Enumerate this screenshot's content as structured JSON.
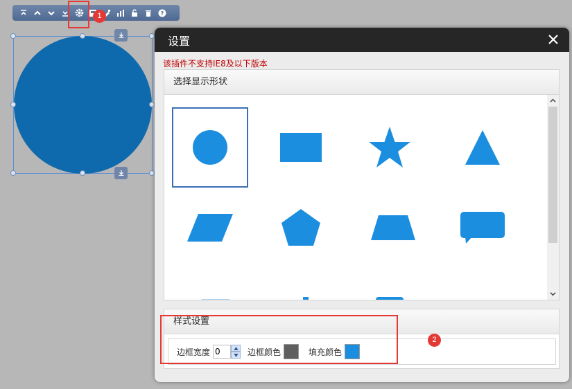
{
  "toolbar": {
    "buttons": [
      {
        "name": "move-top-icon",
        "glyph": "top"
      },
      {
        "name": "move-up-icon",
        "glyph": "up"
      },
      {
        "name": "move-down-icon",
        "glyph": "down"
      },
      {
        "name": "move-bottom-icon",
        "glyph": "bottom"
      },
      {
        "name": "gear-icon",
        "glyph": "gear"
      },
      {
        "name": "image-icon",
        "glyph": "image"
      },
      {
        "name": "brush-icon",
        "glyph": "brush"
      },
      {
        "name": "chart-icon",
        "glyph": "chart"
      },
      {
        "name": "unlock-icon",
        "glyph": "lock"
      },
      {
        "name": "trash-icon",
        "glyph": "trash"
      },
      {
        "name": "help-icon",
        "glyph": "help"
      }
    ]
  },
  "badges": {
    "step1": "1",
    "step2": "2"
  },
  "dialog": {
    "title": "设置",
    "warning": "该插件不支持IE8及以下版本",
    "shape_panel_title": "选择显示形状",
    "style_panel_title": "样式设置",
    "shapes": [
      "circle",
      "rectangle",
      "star",
      "triangle",
      "parallelogram",
      "pentagon",
      "trapezoid",
      "speech-bubble"
    ],
    "selected_shape": "circle",
    "style": {
      "border_width_label": "边框宽度",
      "border_width_value": "0",
      "border_color_label": "边框颜色",
      "border_color": "#5f5f5f",
      "fill_color_label": "填充颜色",
      "fill_color": "#1b8ee0"
    }
  },
  "colors": {
    "shape_fill": "#1b8ee0",
    "canvas_shape": "#0f6aad",
    "highlight": "#e53935"
  }
}
